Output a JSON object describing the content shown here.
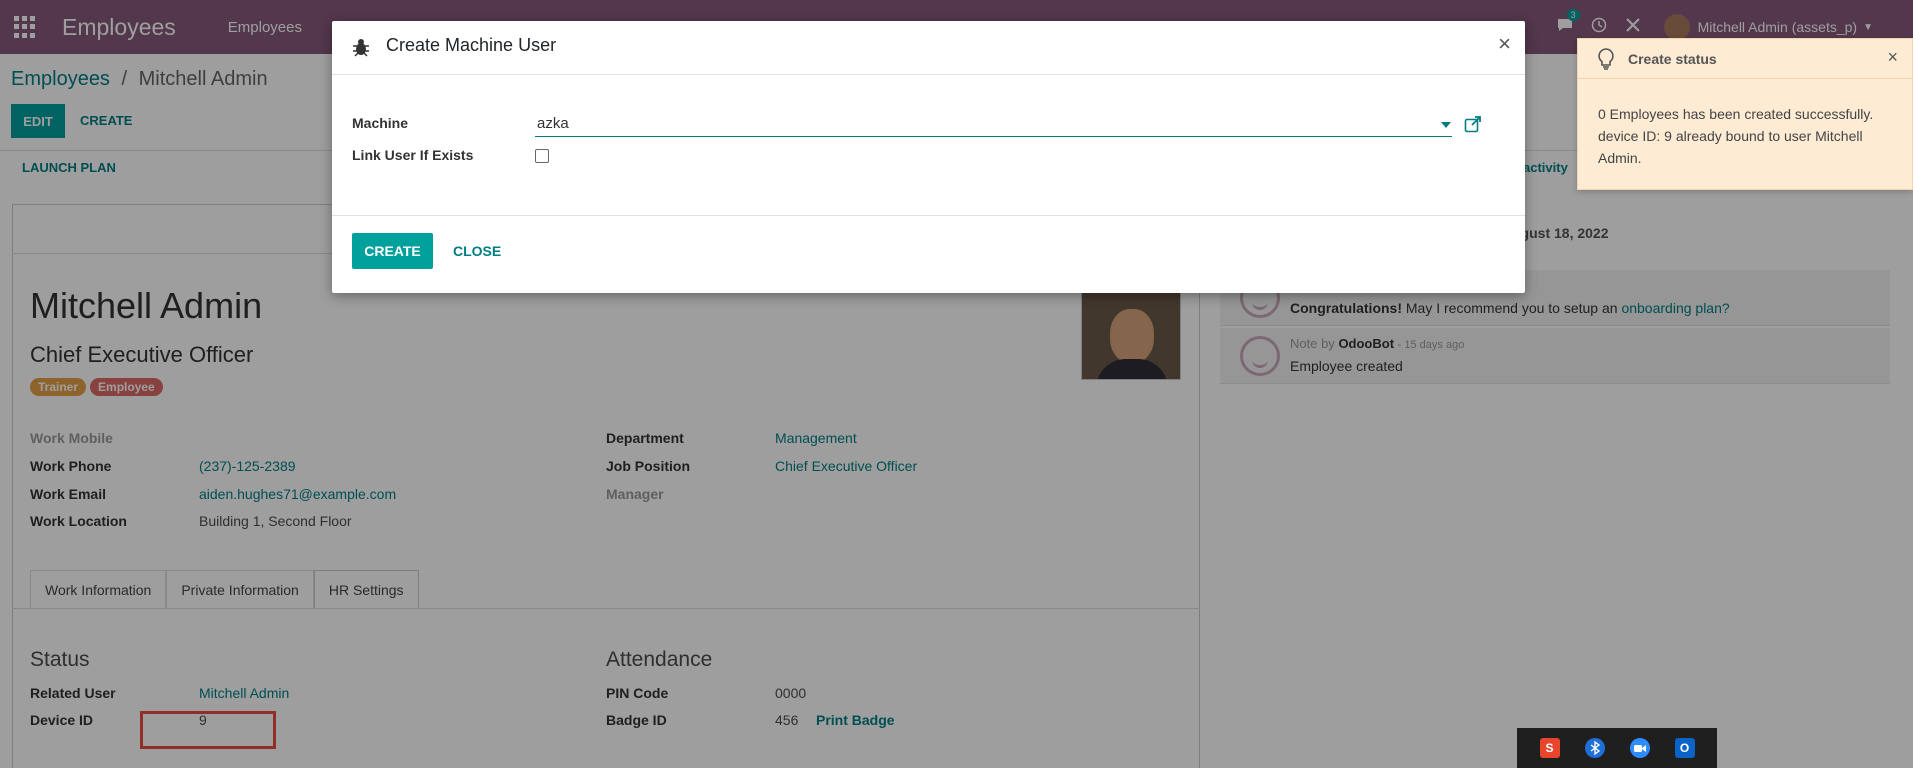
{
  "navbar": {
    "brand": "Employees",
    "menu_first": "Employees",
    "chat_badge": "3",
    "user_name": "Mitchell Admin (assets_p)"
  },
  "breadcrumb": {
    "parent": "Employees",
    "current": "Mitchell Admin"
  },
  "control_panel": {
    "edit_label": "EDIT",
    "create_label": "CREATE",
    "launch_plan_label": "LAUNCH PLAN",
    "activity_label": "activity"
  },
  "employee": {
    "name": "Mitchell Admin",
    "job_title": "Chief Executive Officer",
    "tags": [
      "Trainer",
      "Employee"
    ],
    "fields_left": [
      {
        "label": "Work Mobile",
        "value": ""
      },
      {
        "label": "Work Phone",
        "value": "(237)-125-2389"
      },
      {
        "label": "Work Email",
        "value": "aiden.hughes71@example.com"
      },
      {
        "label": "Work Location",
        "value": "Building 1, Second Floor"
      }
    ],
    "fields_right": [
      {
        "label": "Department",
        "value": "Management"
      },
      {
        "label": "Job Position",
        "value": "Chief Executive Officer"
      },
      {
        "label": "Manager",
        "value": ""
      }
    ]
  },
  "tabs": [
    "Work Information",
    "Private Information",
    "HR Settings"
  ],
  "hr_settings": {
    "status_title": "Status",
    "related_user_label": "Related User",
    "related_user_value": "Mitchell Admin",
    "device_id_label": "Device ID",
    "device_id_value": "9",
    "attendance_title": "Attendance",
    "pin_label": "PIN Code",
    "pin_value": "0000",
    "badge_label": "Badge ID",
    "badge_value": "456",
    "print_badge_label": "Print Badge"
  },
  "chatter": {
    "date": "ugust 18, 2022",
    "message1_strong": "Congratulations!",
    "message1_text": "May I recommend you to setup an",
    "message1_link": "onboarding plan?",
    "note_prefix": "Note by",
    "note_author": "OdooBot",
    "note_time": "- 15 days ago",
    "note_text": "Employee created"
  },
  "modal": {
    "title": "Create Machine User",
    "close_glyph": "×",
    "machine_label": "Machine",
    "machine_value": "azka",
    "link_user_label": "Link User If Exists",
    "link_user_checked": false,
    "create_label": "CREATE",
    "close_label": "CLOSE"
  },
  "notification": {
    "title": "Create status",
    "close_glyph": "×",
    "body": "0 Employees has been created successfully. device ID: 9 already bound to user Mitchell Admin."
  },
  "colors": {
    "navbar": "#875a7b",
    "primary": "#00a09d",
    "link": "#017e84",
    "notification_bg": "#fdebd4",
    "highlight_box": "#e74c3c"
  },
  "tray_icons": [
    "sublime-icon",
    "bluetooth-icon",
    "zoom-icon",
    "outlook-icon"
  ]
}
